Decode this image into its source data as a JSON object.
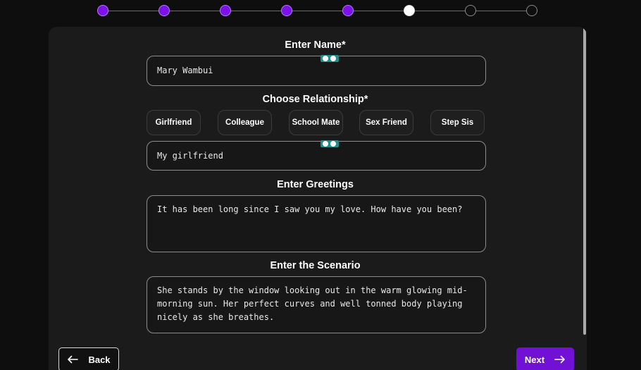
{
  "stepper": {
    "total_steps": 8,
    "current_step": 6,
    "steps": [
      "done",
      "done",
      "done",
      "done",
      "done",
      "current",
      "todo",
      "todo"
    ]
  },
  "form": {
    "name_label": "Enter Name*",
    "name_value": "Mary Wambui",
    "relationship_label": "Choose Relationship*",
    "relationship_options": [
      "Girlfriend",
      "Colleague",
      "School Mate",
      "Sex Friend",
      "Step Sis"
    ],
    "relationship_value": "My girlfriend",
    "greetings_label": "Enter Greetings",
    "greetings_value": "It has been long since I saw you my love. How have you been?",
    "scenario_label": "Enter the Scenario",
    "scenario_value": "She stands by the window looking out in the warm glowing mid-morning sun. Her perfect curves and well tonned body playing nicely as she breathes."
  },
  "nav": {
    "back_label": "Back",
    "next_label": "Next"
  },
  "colors": {
    "accent": "#7111d6",
    "step_done": "#7b12e8",
    "card_bg": "#1b1b1b",
    "page_bg": "#0e0e0e"
  },
  "icons": {
    "back": "arrow-left-icon",
    "next": "arrow-right-icon",
    "field_extension": "password-manager-icon"
  }
}
